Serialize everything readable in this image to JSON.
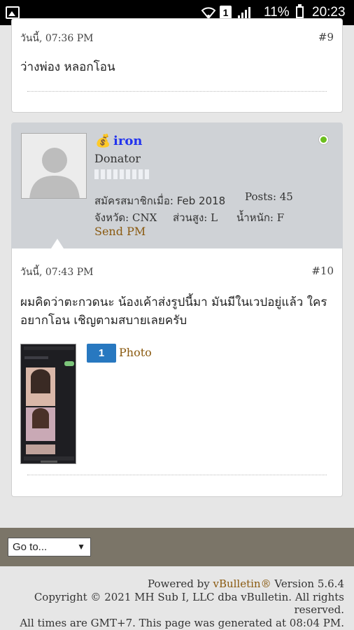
{
  "status_bar": {
    "battery": "11%",
    "time": "20:23",
    "sim": "1"
  },
  "post9": {
    "date": "วันนี้, 07:36 PM",
    "number": "#9",
    "text": "ว่างพ่อง หลอกโอน"
  },
  "post10": {
    "author": {
      "name": "iron",
      "rank": "Donator",
      "joined": "สมัครสมาชิกเมื่อ: Feb 2018",
      "posts": "Posts: 45",
      "province": "จังหวัด: CNX",
      "height": "ส่วนสูง: L",
      "weight": "น้ำหนัก: F",
      "send_pm": "Send PM"
    },
    "date": "วันนี้, 07:43 PM",
    "number": "#10",
    "text_line1": "ผมคิดว่าตะกวดนะ น้องเค้าส่งรูปนี้มา มันมีในเวปอยู่แล้ว ใคร",
    "text_line2": "อยากโอน เชิญตามสบายเลยครับ",
    "photo_count": "1",
    "photo_label": "Photo"
  },
  "goto": {
    "label": "Go to...",
    "arrow": "▼"
  },
  "footer": {
    "powered_prefix": "Powered by ",
    "powered_brand": "vBulletin®",
    "powered_suffix": " Version 5.6.4",
    "copyright_line1": "Copyright © 2021 MH Sub I, LLC dba vBulletin. All rights",
    "copyright_line2": "reserved.",
    "timezone": "All times are GMT+7. This page was generated at 08:04 PM."
  },
  "colors": {
    "link_gold": "#8a5a10",
    "username_blue": "#2233ee",
    "online_green": "#6cbf1f",
    "badge_blue": "#2878c0"
  }
}
